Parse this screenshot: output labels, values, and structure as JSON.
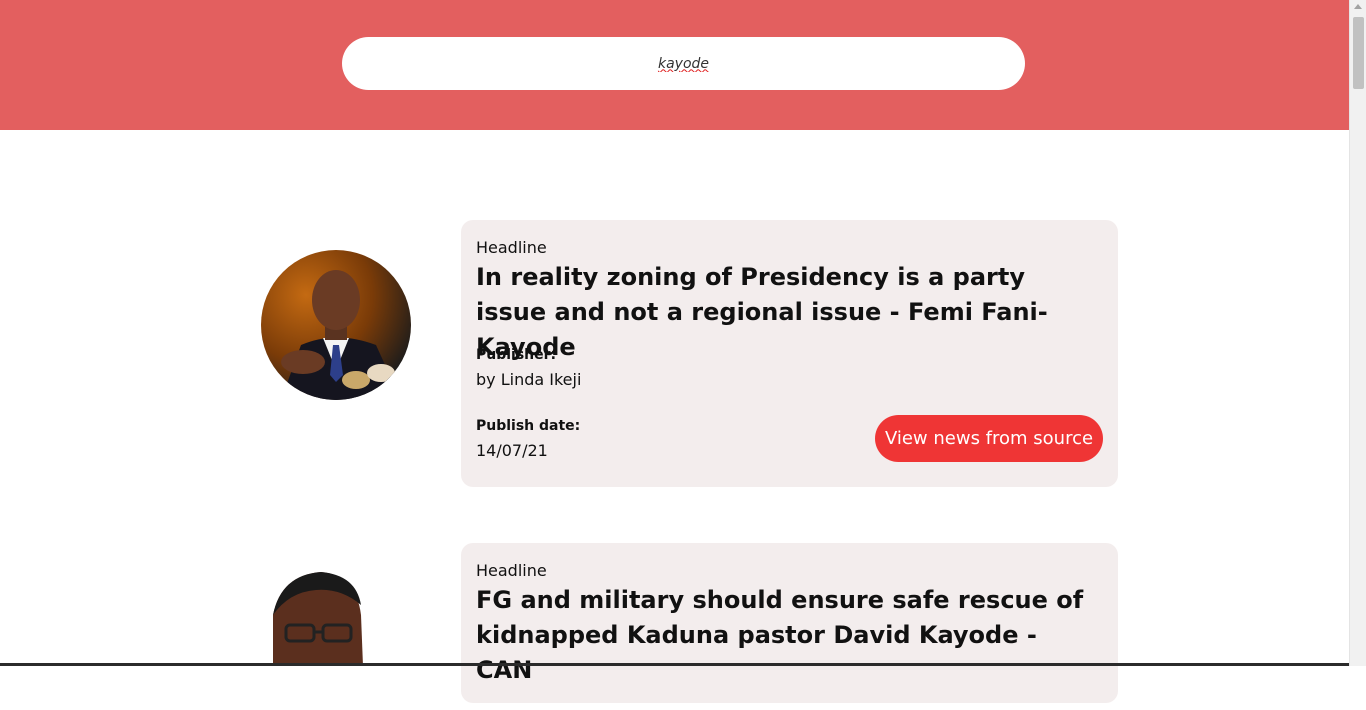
{
  "search": {
    "value": "kayode"
  },
  "articles": [
    {
      "headline_label": "Headline",
      "headline": "In reality zoning of Presidency is a party issue and not a regional issue - Femi Fani-Kayode",
      "publisher_label": "Publisher:",
      "publisher": "by Linda Ikeji",
      "date_label": "Publish date:",
      "date": "14/07/21",
      "button_label": "View news from source"
    },
    {
      "headline_label": "Headline",
      "headline": "FG and military should ensure safe rescue of kidnapped Kaduna pastor David Kayode - CAN"
    }
  ],
  "colors": {
    "header": "#e35f5f",
    "button": "#ef3535",
    "card": "#f3eded"
  }
}
